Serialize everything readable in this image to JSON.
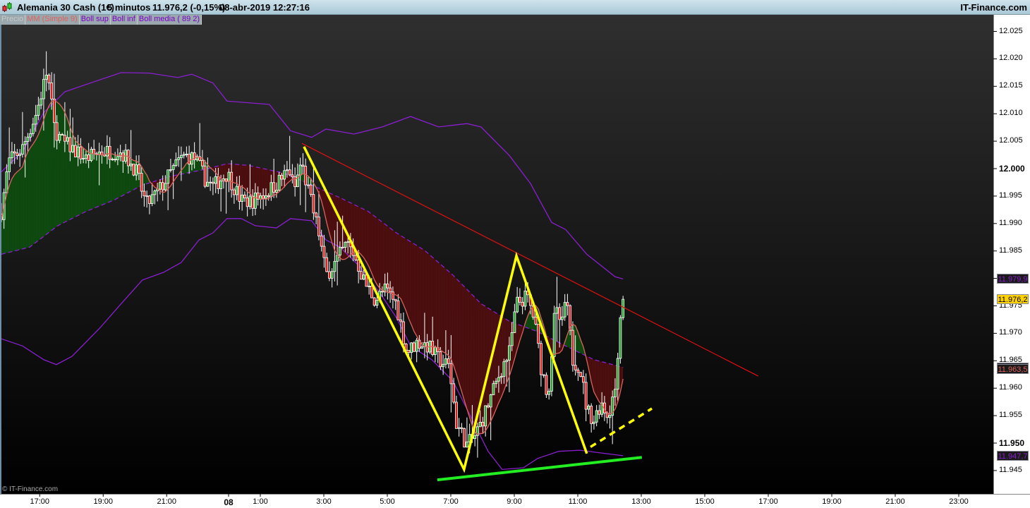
{
  "header": {
    "instrument": "Alemania 30 Cash (1€)",
    "timeframe": "5 minutos",
    "last_price": "11.976,2 (-0,15%)",
    "datetime": "08-abr-2019 12:27:16",
    "brand": "IT-Finance.com"
  },
  "legend": [
    "Precio",
    "MM (Simple 9)",
    "Boll sup",
    "Boll inf",
    "Boll media ( 89 2)"
  ],
  "copyright": "© IT-Finance.com",
  "colors": {
    "up": "#1fa62a",
    "down": "#e01818",
    "mm": "#d8645c",
    "boll": "#8a1fd0",
    "fill_up": "#0e4a10",
    "fill_down": "#4c0e0e",
    "trend_red": "#e01010",
    "zigzag": "#ffff00",
    "support": "#22ee22",
    "last_price_bg": "#ffd200"
  },
  "chart_data": {
    "type": "candlestick",
    "title": "Alemania 30 Cash (1€) 5 minutos",
    "bar_interval_minutes": 5,
    "first_bar_time": "15:45",
    "ylim": [
      11942,
      12028
    ],
    "y_ticks": [
      "12.025",
      "12.020",
      "12.015",
      "12.010",
      "12.005",
      "12.000",
      "11.995",
      "11.990",
      "11.985",
      "11.980",
      "11.975",
      "11.970",
      "11.965",
      "11.960",
      "11.955",
      "11.950",
      "11.945"
    ],
    "y_tick_values": [
      12025,
      12020,
      12015,
      12010,
      12005,
      12000,
      11995,
      11990,
      11985,
      11980,
      11975,
      11970,
      11965,
      11960,
      11955,
      11950,
      11945
    ],
    "y_bold": [
      "12.000",
      "11.950"
    ],
    "x_ticks": [
      {
        "label": "17:00",
        "bar": 15
      },
      {
        "label": "19:00",
        "bar": 39
      },
      {
        "label": "21:00",
        "bar": 63
      },
      {
        "label": "08",
        "bar": 86.4,
        "bold": true
      },
      {
        "label": "1:00",
        "bar": 98.4
      },
      {
        "label": "3:00",
        "bar": 122.4
      },
      {
        "label": "5:00",
        "bar": 146.4
      },
      {
        "label": "7:00",
        "bar": 170.4
      },
      {
        "label": "9:00",
        "bar": 194.4
      },
      {
        "label": "11:00",
        "bar": 218.4
      },
      {
        "label": "13:00",
        "bar": 242.4
      },
      {
        "label": "15:00",
        "bar": 266.4
      },
      {
        "label": "17:00",
        "bar": 290.4
      },
      {
        "label": "19:00",
        "bar": 314.4
      },
      {
        "label": "21:00",
        "bar": 338.4
      },
      {
        "label": "23:00",
        "bar": 362.4
      }
    ],
    "close_path": [
      [
        0,
        11992.2
      ],
      [
        2.7,
        12001.2
      ],
      [
        8,
        12003.7
      ],
      [
        13.3,
        12010.2
      ],
      [
        17.3,
        12017.9
      ],
      [
        20,
        12007.6
      ],
      [
        22.7,
        12005.0
      ],
      [
        26.7,
        12003.7
      ],
      [
        32,
        12001.8
      ],
      [
        37.3,
        12003.1
      ],
      [
        45.3,
        12003.1
      ],
      [
        50.7,
        11999.9
      ],
      [
        54.7,
        11993.4
      ],
      [
        58.7,
        11995.4
      ],
      [
        66.7,
        12001.2
      ],
      [
        69.3,
        12002.4
      ],
      [
        73.3,
        12001.8
      ],
      [
        77.3,
        11997.9
      ],
      [
        80,
        11996.7
      ],
      [
        85.3,
        11999.2
      ],
      [
        90.7,
        11994.1
      ],
      [
        94.7,
        11994.1
      ],
      [
        101.3,
        11996.0
      ],
      [
        106.7,
        11998.6
      ],
      [
        108.8,
        11999.9
      ],
      [
        110.7,
        11996.0
      ],
      [
        113.3,
        12001.2
      ],
      [
        117.3,
        11993.4
      ],
      [
        120,
        11988.3
      ],
      [
        122.7,
        11980.6
      ],
      [
        126.7,
        11983.2
      ],
      [
        130.7,
        11986.4
      ],
      [
        133.3,
        11984.4
      ],
      [
        137.3,
        11979.3
      ],
      [
        141.3,
        11976.1
      ],
      [
        145.3,
        11978.0
      ],
      [
        149.3,
        11975.4
      ],
      [
        153.3,
        11966.5
      ],
      [
        157.3,
        11968.4
      ],
      [
        161.3,
        11967.7
      ],
      [
        165.3,
        11965.2
      ],
      [
        169.3,
        11963.9
      ],
      [
        172,
        11953.6
      ],
      [
        176,
        11949.7
      ],
      [
        178.7,
        11951.0
      ],
      [
        181.3,
        11953.6
      ],
      [
        185.3,
        11958.7
      ],
      [
        189.3,
        11963.9
      ],
      [
        192,
        11966.5
      ],
      [
        194.7,
        11975.4
      ],
      [
        198.7,
        11976.7
      ],
      [
        201.3,
        11972.9
      ],
      [
        204,
        11963.9
      ],
      [
        206.7,
        11958.7
      ],
      [
        209.3,
        11974.2
      ],
      [
        212,
        11971.6
      ],
      [
        213.3,
        11976.7
      ],
      [
        216,
        11965.2
      ],
      [
        218.7,
        11963.9
      ],
      [
        221.3,
        11956.2
      ],
      [
        224,
        11954.2
      ],
      [
        226.7,
        11957.5
      ],
      [
        229.3,
        11954.9
      ],
      [
        232,
        11960.0
      ],
      [
        233.9,
        11972.9
      ],
      [
        235,
        11976.2
      ]
    ],
    "boll_sup": [
      [
        0,
        11999.4
      ],
      [
        8,
        12003.1
      ],
      [
        16,
        12010.2
      ],
      [
        24,
        12014.0
      ],
      [
        37.3,
        12016.2
      ],
      [
        45.3,
        12017.5
      ],
      [
        56,
        12017.4
      ],
      [
        66.7,
        12016.6
      ],
      [
        72,
        12017.2
      ],
      [
        80,
        12015.6
      ],
      [
        85.3,
        12012.3
      ],
      [
        93.3,
        12012.0
      ],
      [
        101.3,
        12011.7
      ],
      [
        109.3,
        12006.9
      ],
      [
        117.3,
        12005.7
      ],
      [
        122.7,
        12007.2
      ],
      [
        133.3,
        12006.3
      ],
      [
        144,
        12007.6
      ],
      [
        154.7,
        12009.5
      ],
      [
        165.3,
        12007.6
      ],
      [
        176,
        12008.2
      ],
      [
        181.3,
        12007.6
      ],
      [
        192,
        12002.4
      ],
      [
        200,
        11997.3
      ],
      [
        208,
        11990.2
      ],
      [
        213.3,
        11988.9
      ],
      [
        221.3,
        11984.4
      ],
      [
        232,
        11980.3
      ],
      [
        235,
        11979.9
      ]
    ],
    "boll_inf": [
      [
        0,
        11969.0
      ],
      [
        8,
        11967.7
      ],
      [
        16,
        11965.2
      ],
      [
        20.8,
        11964.3
      ],
      [
        26.7,
        11965.8
      ],
      [
        37.3,
        11971.0
      ],
      [
        45.3,
        11975.4
      ],
      [
        53.3,
        11979.7
      ],
      [
        61.3,
        11981.1
      ],
      [
        68,
        11982.9
      ],
      [
        74.7,
        11987.0
      ],
      [
        80,
        11988.3
      ],
      [
        85.3,
        11990.9
      ],
      [
        90.7,
        11990.9
      ],
      [
        96,
        11989.6
      ],
      [
        104,
        11989.2
      ],
      [
        109.3,
        11990.9
      ],
      [
        117.3,
        11990.5
      ],
      [
        122.7,
        11987.0
      ],
      [
        128,
        11985.7
      ],
      [
        136,
        11981.9
      ],
      [
        144,
        11976.7
      ],
      [
        149.3,
        11972.9
      ],
      [
        154.7,
        11967.7
      ],
      [
        162.7,
        11965.2
      ],
      [
        170.7,
        11961.3
      ],
      [
        176,
        11956.2
      ],
      [
        184,
        11948.5
      ],
      [
        189.3,
        11945.2
      ],
      [
        197.3,
        11945.5
      ],
      [
        202.7,
        11947.2
      ],
      [
        210.7,
        11948.5
      ],
      [
        218.7,
        11948.7
      ],
      [
        226.7,
        11948.2
      ],
      [
        235,
        11947.7
      ]
    ],
    "boll_media": [
      [
        0,
        11984.4
      ],
      [
        10.7,
        11985.7
      ],
      [
        21.3,
        11989.6
      ],
      [
        32,
        11992.2
      ],
      [
        42.7,
        11994.3
      ],
      [
        53.3,
        11997.0
      ],
      [
        64,
        11998.6
      ],
      [
        77.3,
        11999.9
      ],
      [
        85.3,
        12000.9
      ],
      [
        93.3,
        12000.6
      ],
      [
        106.7,
        11999.2
      ],
      [
        117.3,
        11997.0
      ],
      [
        128,
        11994.7
      ],
      [
        138.7,
        11992.2
      ],
      [
        149.3,
        11988.3
      ],
      [
        160,
        11985.1
      ],
      [
        170.7,
        11980.6
      ],
      [
        181.3,
        11975.4
      ],
      [
        192,
        11972.2
      ],
      [
        202.7,
        11970.3
      ],
      [
        213.3,
        11967.7
      ],
      [
        224,
        11965.2
      ],
      [
        235,
        11963.8
      ]
    ],
    "drawings": {
      "resistance_line": [
        [
          113.6,
          12004.6
        ],
        [
          286.1,
          11962.2
        ]
      ],
      "zigzag": [
        [
          114.4,
          12004.0
        ],
        [
          174.9,
          11945.2
        ],
        [
          194.7,
          11984.1
        ],
        [
          221.3,
          11948.1
        ]
      ],
      "projection_dashed": [
        [
          222.7,
          11949.3
        ],
        [
          245.9,
          11956.3
        ]
      ],
      "support_line": [
        [
          164.8,
          11943.3
        ],
        [
          242.1,
          11947.4
        ]
      ]
    },
    "last_values": [
      {
        "name": "boll_sup",
        "label": "11.979,9",
        "value": 11979.9,
        "bg": "#1a1a1a",
        "fg": "#8a1fd0"
      },
      {
        "name": "price",
        "label": "11.976,2",
        "value": 11976.2,
        "bg": "#ffd200",
        "fg": "#000000"
      },
      {
        "name": "boll_media",
        "label": "11.963,8",
        "value": 11963.8,
        "bg": "#1a1a1a",
        "fg": "#8a1fd0"
      },
      {
        "name": "mm",
        "label": "11.963,5",
        "value": 11963.5,
        "bg": "#1a1a1a",
        "fg": "#e0605a"
      },
      {
        "name": "boll_inf",
        "label": "11.947,7",
        "value": 11947.7,
        "bg": "#1a1a1a",
        "fg": "#8a1fd0"
      }
    ]
  }
}
